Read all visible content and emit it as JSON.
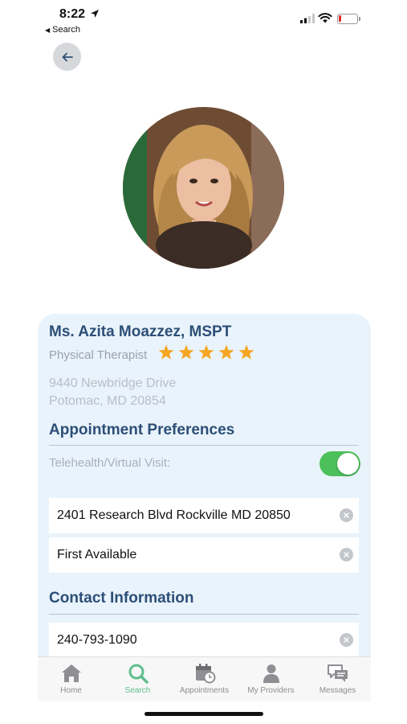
{
  "status_bar": {
    "time": "8:22",
    "back_app_label": "Search"
  },
  "provider": {
    "name": "Ms. Azita Moazzez, MSPT",
    "title": "Physical Therapist",
    "rating": 5,
    "address_line1": "9440 Newbridge Drive",
    "address_line2": "Potomac, MD 20854"
  },
  "appointment_preferences": {
    "heading": "Appointment Preferences",
    "telehealth_label": "Telehealth/Virtual Visit:",
    "telehealth_enabled": true,
    "location_value": "2401 Research Blvd Rockville MD 20850",
    "time_value": "First Available"
  },
  "contact_information": {
    "heading": "Contact Information",
    "phone_value": "240-793-1090"
  },
  "tab_bar": {
    "active": "search",
    "tabs": [
      {
        "id": "home",
        "label": "Home",
        "icon": "home-icon"
      },
      {
        "id": "search",
        "label": "Search",
        "icon": "search-icon"
      },
      {
        "id": "appointments",
        "label": "Appointments",
        "icon": "calendar-clock-icon"
      },
      {
        "id": "providers",
        "label": "My Providers",
        "icon": "person-icon"
      },
      {
        "id": "messages",
        "label": "Messages",
        "icon": "chat-bubbles-icon"
      }
    ]
  },
  "colors": {
    "accent": "#2d4f77",
    "active_tab": "#5fbf8c",
    "star": "#f5a623",
    "toggle_on": "#4cc05a",
    "card_bg": "#e9f3fb"
  }
}
